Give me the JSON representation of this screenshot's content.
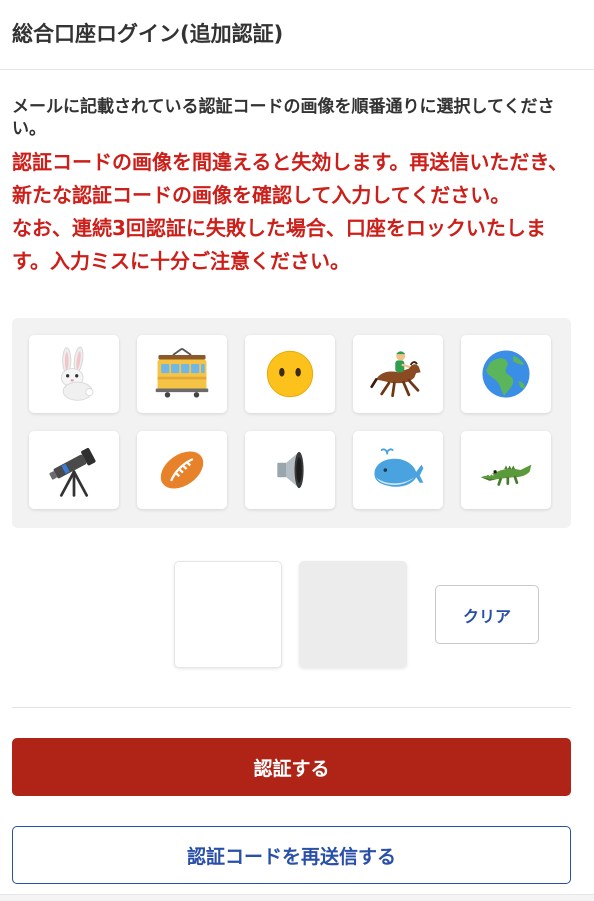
{
  "header": {
    "title": "総合口座ログイン(追加認証)"
  },
  "instructions": "メールに記載されている認証コードの画像を順番通りに選択してください。",
  "warnings": [
    "認証コードの画像を間違えると失効します。再送信いただき、新たな認証コードの画像を確認して入力してください。",
    "なお、連続3回認証に失敗した場合、口座をロックいたします。入力ミスに十分ご注意ください。"
  ],
  "image_grid": {
    "tiles": [
      {
        "icon": "rabbit-icon"
      },
      {
        "icon": "tram-icon"
      },
      {
        "icon": "face-without-mouth-icon"
      },
      {
        "icon": "horse-racing-icon"
      },
      {
        "icon": "globe-americas-icon"
      },
      {
        "icon": "telescope-icon"
      },
      {
        "icon": "rugby-football-icon"
      },
      {
        "icon": "speaker-icon"
      },
      {
        "icon": "whale-icon"
      },
      {
        "icon": "crocodile-icon"
      }
    ]
  },
  "selection": {
    "slots": [
      "",
      ""
    ],
    "clear_label": "クリア"
  },
  "actions": {
    "submit_label": "認証する",
    "resend_label": "認証コードを再送信する"
  },
  "colors": {
    "warning_red": "#cc1f1a",
    "submit_bg": "#b02418",
    "link_blue": "#2a4fa8"
  }
}
